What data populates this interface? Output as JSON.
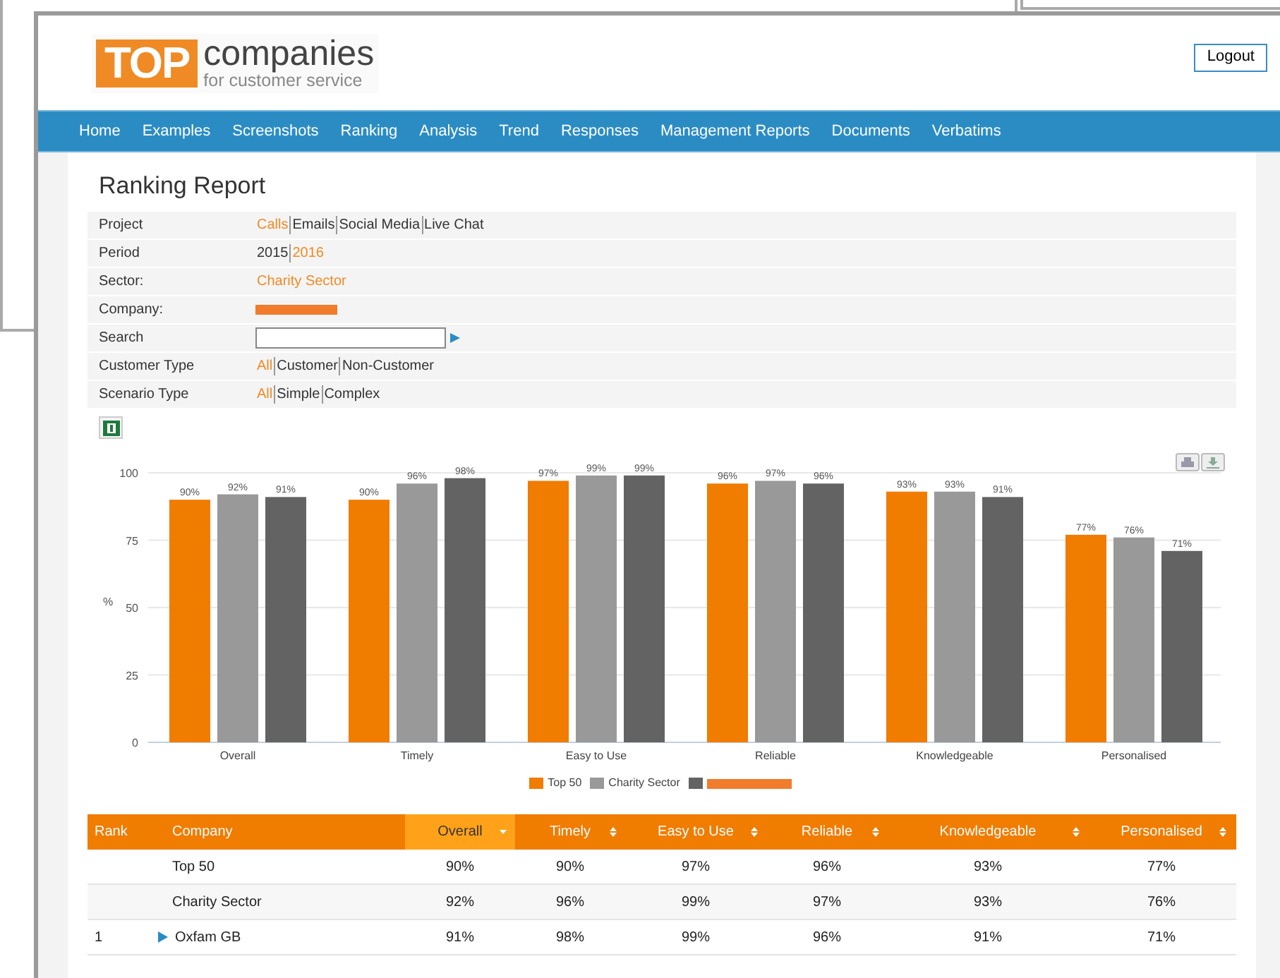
{
  "header": {
    "logo": {
      "box": "TOP",
      "word": "companies",
      "tagline": "for customer service"
    },
    "logout": "Logout"
  },
  "nav": [
    "Home",
    "Examples",
    "Screenshots",
    "Ranking",
    "Analysis",
    "Trend",
    "Responses",
    "Management Reports",
    "Documents",
    "Verbatims"
  ],
  "title": "Ranking Report",
  "filters": [
    {
      "kind": "options",
      "label": "Project",
      "options": [
        {
          "label": "Calls",
          "selected": true
        },
        {
          "label": "Emails",
          "selected": false
        },
        {
          "label": "Social Media",
          "selected": false
        },
        {
          "label": "Live Chat",
          "selected": false
        }
      ]
    },
    {
      "kind": "options",
      "label": "Period",
      "options": [
        {
          "label": "2015",
          "selected": false
        },
        {
          "label": "2016",
          "selected": true
        }
      ]
    },
    {
      "kind": "options",
      "label": "Sector:",
      "options": [
        {
          "label": "Charity Sector",
          "selected": true
        }
      ]
    },
    {
      "kind": "redacted",
      "label": "Company:"
    },
    {
      "kind": "search",
      "label": "Search"
    },
    {
      "kind": "options",
      "label": "Customer Type",
      "options": [
        {
          "label": "All",
          "selected": true
        },
        {
          "label": "Customer",
          "selected": false
        },
        {
          "label": "Non-Customer",
          "selected": false
        }
      ]
    },
    {
      "kind": "options",
      "label": "Scenario Type",
      "options": [
        {
          "label": "All",
          "selected": true
        },
        {
          "label": "Simple",
          "selected": false
        },
        {
          "label": "Complex",
          "selected": false
        }
      ]
    }
  ],
  "chart": {
    "chart_data": {
      "type": "bar",
      "ylabel": "%",
      "categories": [
        "Overall",
        "Timely",
        "Easy to Use",
        "Reliable",
        "Knowledgeable",
        "Personalised"
      ],
      "ylim": [
        0,
        100
      ],
      "yticks": [
        0,
        25,
        50,
        75,
        100
      ],
      "grid": true,
      "legend": true,
      "series": [
        {
          "name": "Top 50",
          "color": "#f07c00",
          "values": [
            90,
            90,
            97,
            96,
            93,
            77
          ],
          "value_labels": [
            "90%",
            "90%",
            "97%",
            "96%",
            "93%",
            "77%"
          ]
        },
        {
          "name": "Charity Sector",
          "color": "#999999",
          "values": [
            92,
            96,
            99,
            97,
            93,
            76
          ],
          "value_labels": [
            "92%",
            "96%",
            "99%",
            "97%",
            "93%",
            "76%"
          ]
        },
        {
          "color": "#636363",
          "values": [
            91,
            98,
            99,
            96,
            91,
            71
          ],
          "value_labels": [
            "91%",
            "98%",
            "99%",
            "96%",
            "91%",
            "71%"
          ]
        }
      ]
    }
  },
  "table": {
    "columns": [
      {
        "label": "Rank",
        "sortable": false,
        "sorted": false
      },
      {
        "label": "Company",
        "sortable": false,
        "sorted": false
      },
      {
        "label": "Overall",
        "sortable": true,
        "sorted": true
      },
      {
        "label": "Timely",
        "sortable": true,
        "sorted": false
      },
      {
        "label": "Easy to Use",
        "sortable": true,
        "sorted": false
      },
      {
        "label": "Reliable",
        "sortable": true,
        "sorted": false
      },
      {
        "label": "Knowledgeable",
        "sortable": true,
        "sorted": false
      },
      {
        "label": "Personalised",
        "sortable": true,
        "sorted": false
      }
    ],
    "rows": [
      {
        "rank": "",
        "company": "Top 50",
        "expandable": false,
        "values": [
          "90%",
          "90%",
          "97%",
          "96%",
          "93%",
          "77%"
        ]
      },
      {
        "rank": "",
        "company": "Charity Sector",
        "expandable": false,
        "values": [
          "92%",
          "96%",
          "99%",
          "97%",
          "93%",
          "76%"
        ]
      },
      {
        "rank": "1",
        "company": "Oxfam GB",
        "expandable": true,
        "values": [
          "91%",
          "98%",
          "99%",
          "96%",
          "91%",
          "71%"
        ]
      }
    ]
  }
}
